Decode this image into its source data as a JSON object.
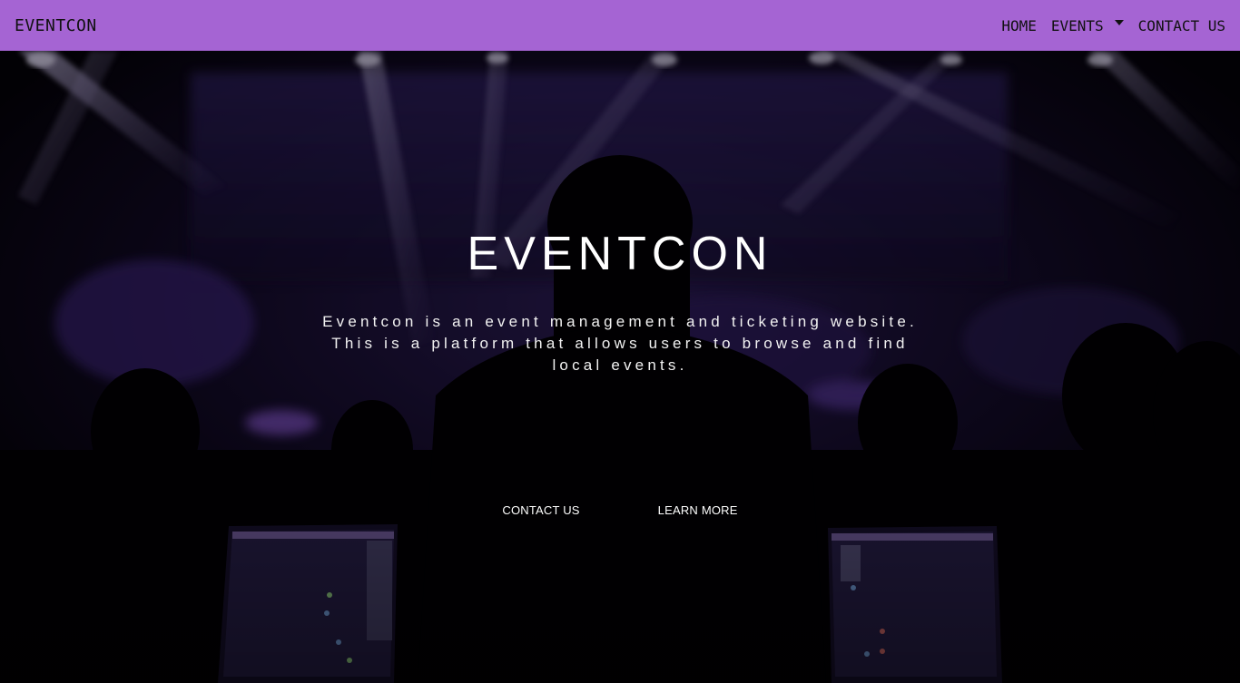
{
  "navbar": {
    "brand": "EVENTCON",
    "links": {
      "home": "HOME",
      "events": "EVENTS",
      "contact": "CONTACT US"
    },
    "background": "#a564d3"
  },
  "hero": {
    "title": "EVENTCON",
    "description": "Eventcon is an event management and ticketing website. This is a platform that allows users to browse and find local events.",
    "buttons": {
      "contact": "CONTACT US",
      "learn_more": "LEARN MORE"
    }
  },
  "icons": [
    "caret-down-icon"
  ]
}
